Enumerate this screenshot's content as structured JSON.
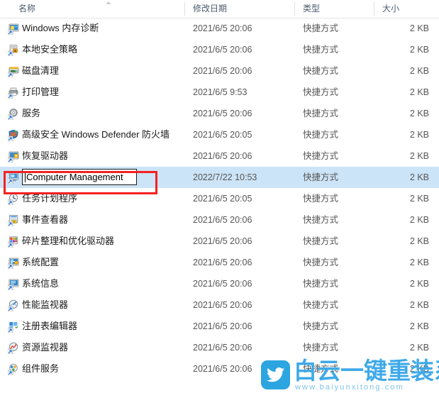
{
  "window": {
    "type": "file-explorer-list-view",
    "selection_color": "#cce4f7",
    "annotation_color": "#f42121"
  },
  "columns": {
    "name": "名称",
    "date_modified": "修改日期",
    "type": "类型",
    "size": "大小",
    "sort_indicator": "ascending-caret"
  },
  "rename_edit": {
    "value": "Computer Management",
    "placeholder": "",
    "active": true
  },
  "rows": [
    {
      "name": "Windows 内存诊断",
      "date": "2021/6/5 20:06",
      "type": "快捷方式",
      "size": "2 KB",
      "icon": "memory-diagnostic-icon",
      "selected": false
    },
    {
      "name": "本地安全策略",
      "date": "2021/6/5 20:06",
      "type": "快捷方式",
      "size": "2 KB",
      "icon": "local-security-policy-icon",
      "selected": false
    },
    {
      "name": "磁盘清理",
      "date": "2021/6/5 20:06",
      "type": "快捷方式",
      "size": "2 KB",
      "icon": "disk-cleanup-icon",
      "selected": false
    },
    {
      "name": "打印管理",
      "date": "2021/6/5 9:53",
      "type": "快捷方式",
      "size": "2 KB",
      "icon": "print-management-icon",
      "selected": false
    },
    {
      "name": "服务",
      "date": "2021/6/5 20:06",
      "type": "快捷方式",
      "size": "2 KB",
      "icon": "services-gear-icon",
      "selected": false
    },
    {
      "name": "高级安全 Windows Defender 防火墙",
      "date": "2021/6/5 20:05",
      "type": "快捷方式",
      "size": "2 KB",
      "icon": "firewall-shield-icon",
      "selected": false
    },
    {
      "name": "恢复驱动器",
      "date": "2021/6/5 20:06",
      "type": "快捷方式",
      "size": "2 KB",
      "icon": "recovery-drive-icon",
      "selected": false
    },
    {
      "name": "Computer Management",
      "date": "2022/7/22 10:53",
      "type": "快捷方式",
      "size": "2 KB",
      "icon": "computer-management-icon",
      "selected": true,
      "renaming": true
    },
    {
      "name": "任务计划程序",
      "date": "2021/6/5 20:05",
      "type": "快捷方式",
      "size": "2 KB",
      "icon": "task-scheduler-clock-icon",
      "selected": false
    },
    {
      "name": "事件查看器",
      "date": "2021/6/5 20:06",
      "type": "快捷方式",
      "size": "2 KB",
      "icon": "event-viewer-icon",
      "selected": false
    },
    {
      "name": "碎片整理和优化驱动器",
      "date": "2021/6/5 20:06",
      "type": "快捷方式",
      "size": "2 KB",
      "icon": "defragment-icon",
      "selected": false
    },
    {
      "name": "系统配置",
      "date": "2021/6/5 20:06",
      "type": "快捷方式",
      "size": "2 KB",
      "icon": "system-configuration-icon",
      "selected": false
    },
    {
      "name": "系统信息",
      "date": "2021/6/5 20:06",
      "type": "快捷方式",
      "size": "2 KB",
      "icon": "system-information-icon",
      "selected": false
    },
    {
      "name": "性能监视器",
      "date": "2021/6/5 20:06",
      "type": "快捷方式",
      "size": "2 KB",
      "icon": "performance-monitor-icon",
      "selected": false
    },
    {
      "name": "注册表编辑器",
      "date": "2021/6/5 20:06",
      "type": "快捷方式",
      "size": "2 KB",
      "icon": "registry-editor-icon",
      "selected": false
    },
    {
      "name": "资源监视器",
      "date": "2021/6/5 20:06",
      "type": "快捷方式",
      "size": "2 KB",
      "icon": "resource-monitor-icon",
      "selected": false
    },
    {
      "name": "组件服务",
      "date": "2021/6/5 20:06",
      "type": "快捷方式",
      "size": "2 KB",
      "icon": "component-services-icon",
      "selected": false
    }
  ],
  "watermark": {
    "title": "白云一键重装系统",
    "url": "www.baiyunxitong.com",
    "logo": "twitter-bird-icon",
    "color": "#3fa9e8"
  }
}
